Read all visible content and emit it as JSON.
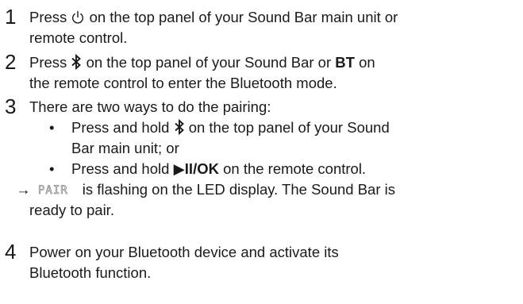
{
  "steps": [
    {
      "number": "1",
      "before_icon": "Press",
      "icon": "power-icon",
      "after_icon": "on the top panel of your Sound Bar main unit or",
      "line2": "remote control."
    },
    {
      "number": "2",
      "before_icon": "Press",
      "icon": "bluetooth-icon",
      "after_icon": "on the top panel of your Sound Bar or",
      "bold": "BT",
      "after_bold": "on",
      "line2": "the remote control to enter the Bluetooth mode."
    },
    {
      "number": "3",
      "text": "There are two ways to do the pairing:",
      "bullets": [
        {
          "dot": "•",
          "before_icon": "Press and hold",
          "icon": "bluetooth-icon",
          "after_icon": "on the top panel of your Sound",
          "line2": "Bar main unit; or"
        },
        {
          "dot": "•",
          "before_icon": "Press and hold",
          "bold": "▶II/OK",
          "after_bold": "on the remote control."
        }
      ],
      "result": {
        "arrow": "→",
        "led_text": "PAIR",
        "after_led": "is flashing on the LED display. The Sound Bar is",
        "line2": "ready to pair."
      }
    },
    {
      "number": "4",
      "line1": "Power on your Bluetooth device and activate its",
      "line2": "Bluetooth function."
    }
  ]
}
